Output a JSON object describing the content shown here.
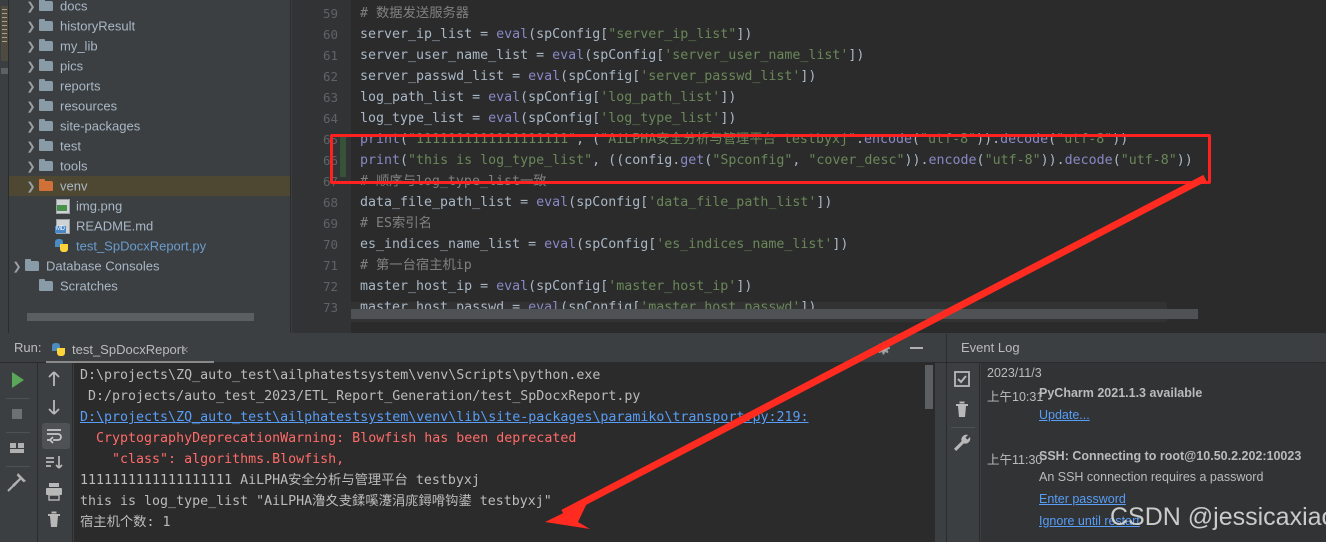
{
  "project": {
    "tool_tab_label": "Project",
    "items": [
      {
        "label": "docs",
        "icon": "folder-icon",
        "indent": 1,
        "expandable": true,
        "selected": false,
        "kind": "folder"
      },
      {
        "label": "historyResult",
        "icon": "folder-icon",
        "indent": 1,
        "expandable": true,
        "selected": false,
        "kind": "folder"
      },
      {
        "label": "my_lib",
        "icon": "folder-icon",
        "indent": 1,
        "expandable": true,
        "selected": false,
        "kind": "folder"
      },
      {
        "label": "pics",
        "icon": "folder-icon",
        "indent": 1,
        "expandable": true,
        "selected": false,
        "kind": "folder"
      },
      {
        "label": "reports",
        "icon": "folder-icon",
        "indent": 1,
        "expandable": true,
        "selected": false,
        "kind": "folder"
      },
      {
        "label": "resources",
        "icon": "folder-icon",
        "indent": 1,
        "expandable": true,
        "selected": false,
        "kind": "folder"
      },
      {
        "label": "site-packages",
        "icon": "folder-icon",
        "indent": 1,
        "expandable": true,
        "selected": false,
        "kind": "folder"
      },
      {
        "label": "test",
        "icon": "folder-icon",
        "indent": 1,
        "expandable": true,
        "selected": false,
        "kind": "folder"
      },
      {
        "label": "tools",
        "icon": "folder-icon",
        "indent": 1,
        "expandable": true,
        "selected": false,
        "kind": "folder"
      },
      {
        "label": "venv",
        "icon": "folder-orange-icon",
        "indent": 1,
        "expandable": true,
        "selected": true,
        "kind": "folder-orange"
      },
      {
        "label": "img.png",
        "icon": "image-file-icon",
        "indent": 2,
        "expandable": false,
        "selected": false,
        "kind": "png"
      },
      {
        "label": "README.md",
        "icon": "markdown-file-icon",
        "indent": 2,
        "expandable": false,
        "selected": false,
        "kind": "md"
      },
      {
        "label": "test_SpDocxReport.py",
        "icon": "python-file-icon",
        "indent": 2,
        "expandable": false,
        "selected": false,
        "kind": "py"
      },
      {
        "label": "Database Consoles",
        "icon": "folder-icon",
        "indent": 0,
        "expandable": true,
        "selected": false,
        "kind": "folder"
      },
      {
        "label": "Scratches",
        "icon": "folder-icon",
        "indent": 1,
        "expandable": false,
        "selected": false,
        "kind": "folder"
      }
    ]
  },
  "editor": {
    "line_numbers": [
      "59",
      "60",
      "61",
      "62",
      "63",
      "64",
      "65",
      "66",
      "67",
      "68",
      "69",
      "70",
      "71",
      "72",
      "73"
    ],
    "lines": [
      {
        "no": "59",
        "text": "# 数据发送服务器"
      },
      {
        "no": "60",
        "text": "server_ip_list = eval(spConfig[\"server_ip_list\"])"
      },
      {
        "no": "61",
        "text": "server_user_name_list = eval(spConfig['server_user_name_list'])"
      },
      {
        "no": "62",
        "text": "server_passwd_list = eval(spConfig['server_passwd_list'])"
      },
      {
        "no": "63",
        "text": "log_path_list = eval(spConfig['log_path_list'])"
      },
      {
        "no": "64",
        "text": "log_type_list = eval(spConfig['log_type_list'])"
      },
      {
        "no": "65",
        "text": "print(\"1111111111111111111\", (\"AiLPHA安全分析与管理平台 testbyxj\".encode(\"utf-8\")).decode(\"utf-8\"))"
      },
      {
        "no": "66",
        "text": "print(\"this is log_type_list\", ((config.get(\"Spconfig\", \"cover_desc\")).encode(\"utf-8\")).decode(\"utf-8\"))"
      },
      {
        "no": "67",
        "text": "# 顺序与log_type_list一致"
      },
      {
        "no": "68",
        "text": "data_file_path_list = eval(spConfig['data_file_path_list'])"
      },
      {
        "no": "69",
        "text": "# ES索引名"
      },
      {
        "no": "70",
        "text": "es_indices_name_list = eval(spConfig['es_indices_name_list'])"
      },
      {
        "no": "71",
        "text": "# 第一台宿主机ip"
      },
      {
        "no": "72",
        "text": "master_host_ip = eval(spConfig['master_host_ip'])"
      },
      {
        "no": "73",
        "text": "master_host_passwd = eval(spConfig['master_host_passwd'])"
      }
    ]
  },
  "run_panel": {
    "run_label": "Run:",
    "tab_label": "test_SpDocxReport",
    "close_icon": "×",
    "gear_icon": "gear-icon",
    "minimize_icon": "minimize-icon",
    "console_lines": [
      {
        "text": "D:\\projects\\ZQ_auto_test\\ailphatestsystem\\venv\\Scripts\\python.exe",
        "style": "plain"
      },
      {
        "text": " D:/projects/auto_test_2023/ETL_Report_Generation/test_SpDocxReport.py",
        "style": "plain"
      },
      {
        "text": "D:\\projects\\ZQ_auto_test\\ailphatestsystem\\venv\\lib\\site-packages\\paramiko\\transport.py:219:",
        "style": "link"
      },
      {
        "text": "  CryptographyDeprecationWarning: Blowfish has been deprecated",
        "style": "red"
      },
      {
        "text": "    \"class\": algorithms.Blowfish,",
        "style": "red"
      },
      {
        "text": "1111111111111111111 AiLPHA安全分析与管理平台 testbyxj",
        "style": "plain"
      },
      {
        "text": "this is log_type_list \"AiLPHA澛夊叏鍒嗘瀽涓庣鐞嗗钩鍙 testbyxj\"",
        "style": "plain"
      },
      {
        "text": "宿主机个数: 1",
        "style": "plain"
      }
    ],
    "toolbar_left": [
      "run-icon",
      "stop-icon",
      "layout-icon",
      "pin-icon"
    ],
    "toolbar_right": [
      "scroll-up-icon",
      "scroll-down-icon",
      "soft-wrap-icon",
      "scroll-to-end-icon",
      "print-icon",
      "clear-all-icon"
    ]
  },
  "event_log": {
    "title": "Event Log",
    "toolbar": [
      "mark-read-icon",
      "clear-icon",
      "settings-wrench-icon"
    ],
    "entries": [
      {
        "type": "date",
        "text": "2023/11/3"
      },
      {
        "type": "event",
        "time": "上午10:31",
        "title": "PyCharm 2021.1.3 available",
        "links": [
          "Update..."
        ],
        "body": ""
      },
      {
        "type": "event",
        "time": "上午11:30",
        "title": "SSH: Connecting to root@10.50.2.202:10023",
        "body": "An SSH connection requires a password",
        "links": [
          "Enter password",
          "Ignore until restart"
        ]
      }
    ]
  },
  "watermark": {
    "text": "CSDN @jessicaxiaojing"
  },
  "annotation": {
    "highlight_box_color": "#ff2020",
    "arrow_color": "#ff2a20"
  }
}
